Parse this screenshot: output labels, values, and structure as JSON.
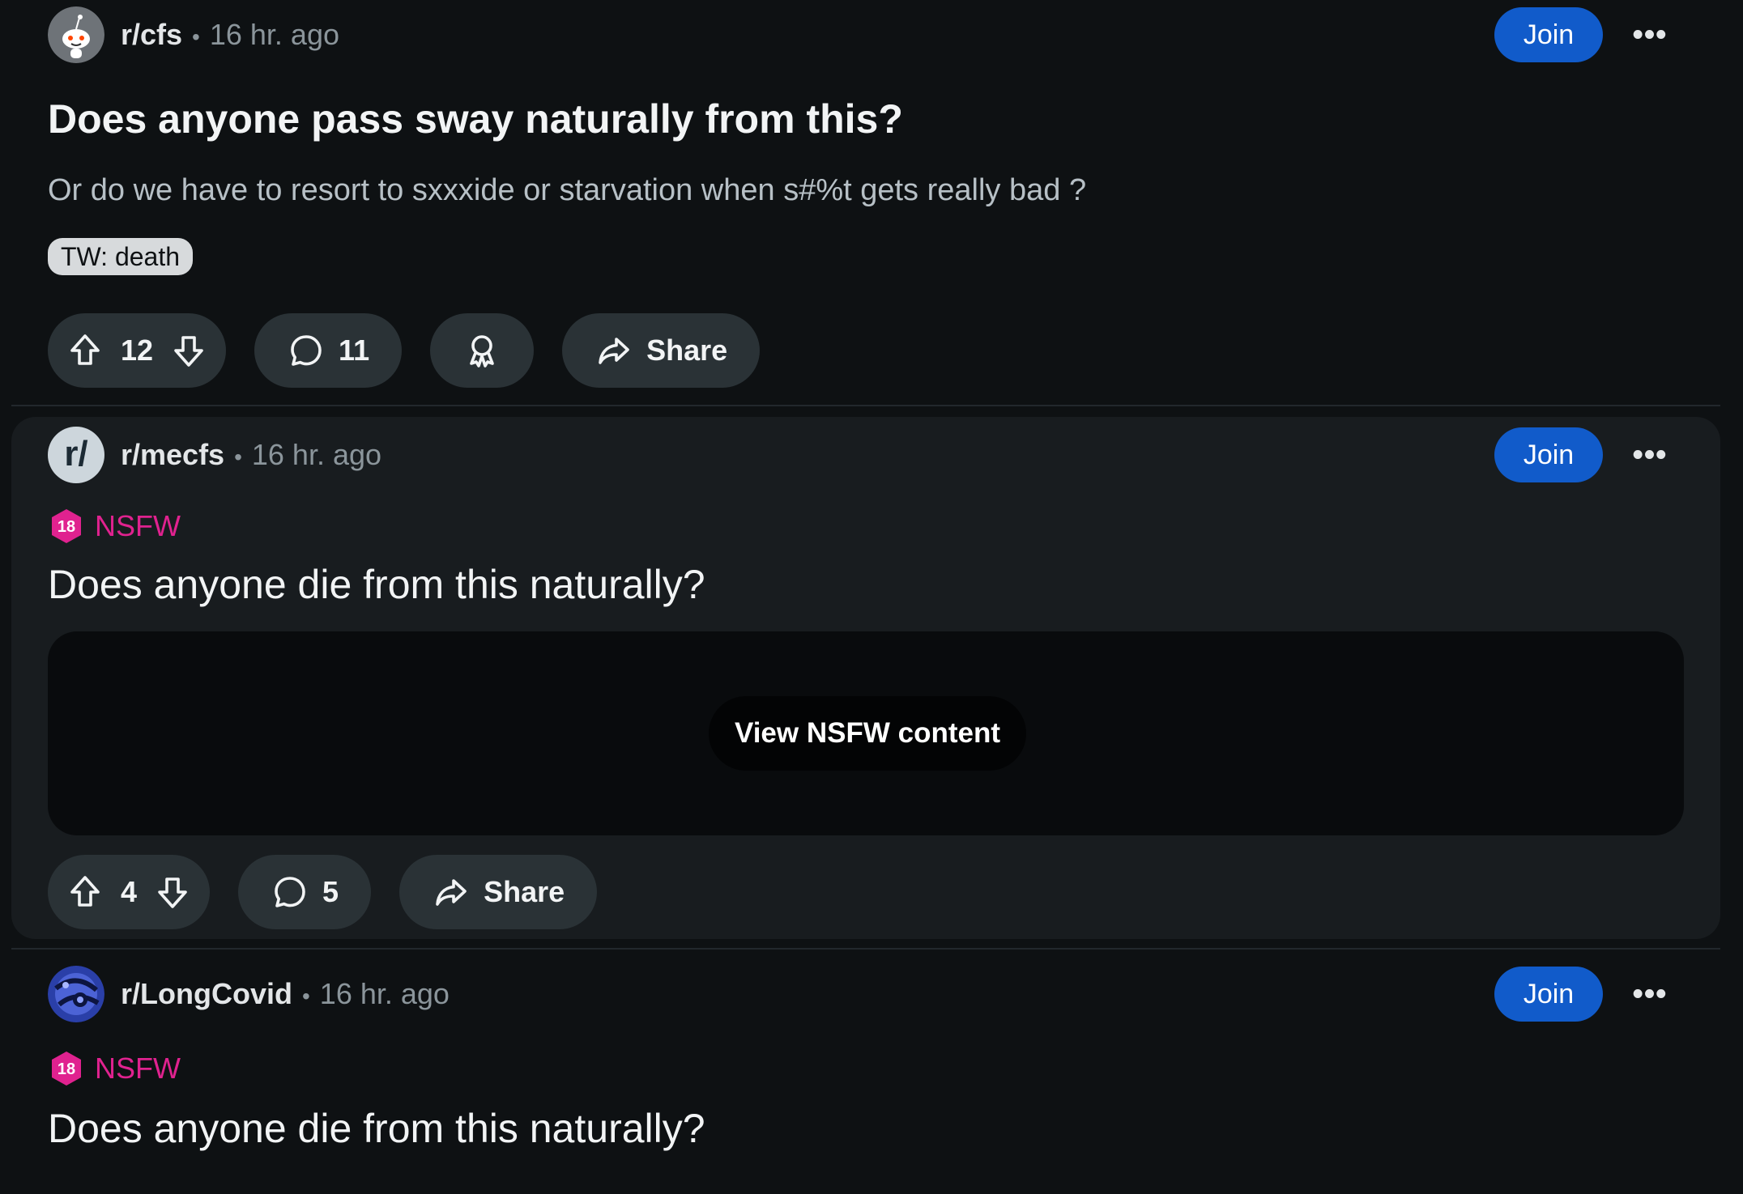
{
  "posts": [
    {
      "subreddit": "r/cfs",
      "separator": "•",
      "time": "16 hr. ago",
      "join_label": "Join",
      "more_label": "•••",
      "title": "Does anyone pass sway naturally from this?",
      "body": "Or do we have to resort to sxxxide or starvation when s#%t gets really bad ?",
      "flair": "TW: death",
      "upvotes": "12",
      "comments": "11",
      "share_label": "Share"
    },
    {
      "subreddit": "r/mecfs",
      "avatar_text": "r/",
      "separator": "•",
      "time": "16 hr. ago",
      "join_label": "Join",
      "more_label": "•••",
      "nsfw_label": "NSFW",
      "nsfw_badge": "18",
      "title": "Does anyone die from this naturally?",
      "view_nsfw_label": "View NSFW content",
      "upvotes": "4",
      "comments": "5",
      "share_label": "Share"
    },
    {
      "subreddit": "r/LongCovid",
      "separator": "•",
      "time": "16 hr. ago",
      "join_label": "Join",
      "more_label": "•••",
      "nsfw_label": "NSFW",
      "nsfw_badge": "18",
      "title": "Does anyone die from this naturally?"
    }
  ],
  "colors": {
    "background": "#0e1113",
    "join_button": "#115bca",
    "nsfw": "#e0228f",
    "pill": "#2a3236",
    "highlight_card": "#181c1f"
  },
  "icons": [
    "snoo-avatar-icon",
    "upvote-icon",
    "downvote-icon",
    "comment-icon",
    "award-icon",
    "share-icon",
    "nsfw-18-icon",
    "more-icon"
  ]
}
